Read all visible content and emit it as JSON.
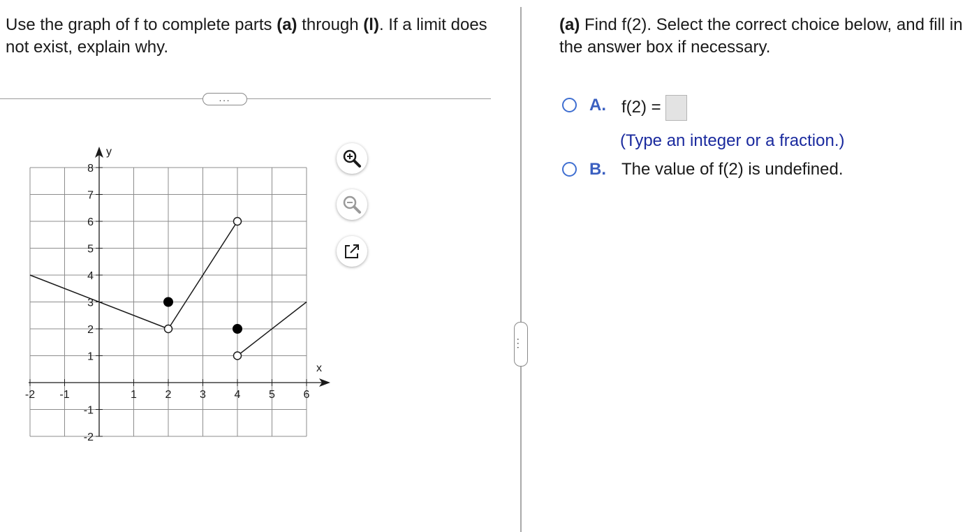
{
  "prompt": {
    "text_1": "Use the graph of f to complete parts ",
    "part_a": "(a)",
    "text_2": " through ",
    "part_l": "(l)",
    "text_3": ". If a limit does not exist, explain why."
  },
  "more_indicator": "...",
  "graph": {
    "x_axis_label": "x",
    "y_axis_label": "y",
    "x_ticks": [
      "-2",
      "-1",
      "1",
      "2",
      "3",
      "4",
      "5",
      "6"
    ],
    "y_ticks": [
      "8",
      "7",
      "6",
      "5",
      "4",
      "3",
      "2",
      "1",
      "-1",
      "-2"
    ],
    "x_range": [
      -2,
      6
    ],
    "y_range": [
      -2,
      8
    ],
    "segments": [
      {
        "from": [
          -2,
          4
        ],
        "to": [
          2,
          2
        ]
      },
      {
        "from": [
          2,
          2
        ],
        "to": [
          4,
          6
        ]
      },
      {
        "from": [
          4,
          1
        ],
        "to": [
          6,
          3
        ]
      }
    ],
    "open_points": [
      [
        2,
        2
      ],
      [
        4,
        6
      ],
      [
        4,
        1
      ]
    ],
    "closed_points": [
      [
        2,
        3
      ],
      [
        4,
        2
      ]
    ]
  },
  "tools": {
    "zoom_in": "zoom-in-icon",
    "zoom_out": "zoom-out-icon",
    "popout": "popout-icon"
  },
  "question": {
    "part": "(a)",
    "text": " Find f(2). Select the correct choice below, and fill in the answer box if necessary."
  },
  "choices": [
    {
      "letter": "A.",
      "prefix": "f(2) =",
      "hint": "(Type an integer or a fraction.)"
    },
    {
      "letter": "B.",
      "text": "The value of f(2) is undefined."
    }
  ],
  "colors": {
    "accent": "#3a5fc0",
    "hint": "#1a2a9e",
    "grid": "#8c8c8c"
  }
}
